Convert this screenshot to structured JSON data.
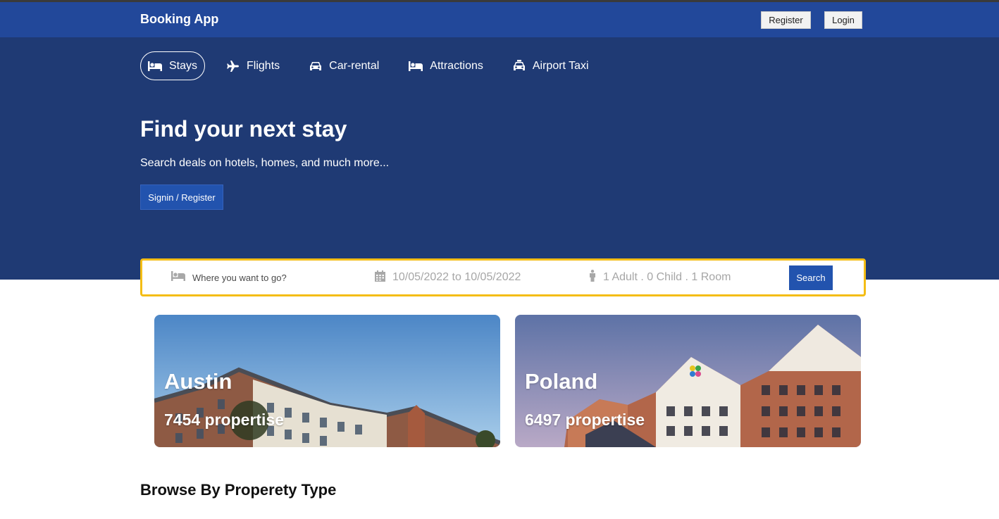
{
  "navbar": {
    "brand": "Booking App",
    "register_label": "Register",
    "login_label": "Login"
  },
  "tabs": [
    {
      "label": "Stays",
      "icon": "bed-icon",
      "active": true
    },
    {
      "label": "Flights",
      "icon": "plane-icon",
      "active": false
    },
    {
      "label": "Car-rental",
      "icon": "car-icon",
      "active": false
    },
    {
      "label": "Attractions",
      "icon": "bed-icon",
      "active": false
    },
    {
      "label": "Airport Taxi",
      "icon": "taxi-icon",
      "active": false
    }
  ],
  "hero": {
    "title": "Find your next stay",
    "subtitle": "Search deals on hotels, homes, and much more...",
    "signin_label": "Signin / Register"
  },
  "search": {
    "destination_placeholder": "Where you want to go?",
    "dates": "10/05/2022 to 10/05/2022",
    "guests": "1 Adult . 0 Child . 1 Room",
    "button_label": "Search"
  },
  "featured": [
    {
      "city": "Austin",
      "count": "7454 propertise"
    },
    {
      "city": "Poland",
      "count": "6497 propertise"
    }
  ],
  "sections": {
    "browse_title": "Browse By Properety Type"
  },
  "colors": {
    "navbar": "#22489a",
    "hero": "#1f3a74",
    "accent": "#2253ae",
    "search_border": "#f4bd15"
  }
}
